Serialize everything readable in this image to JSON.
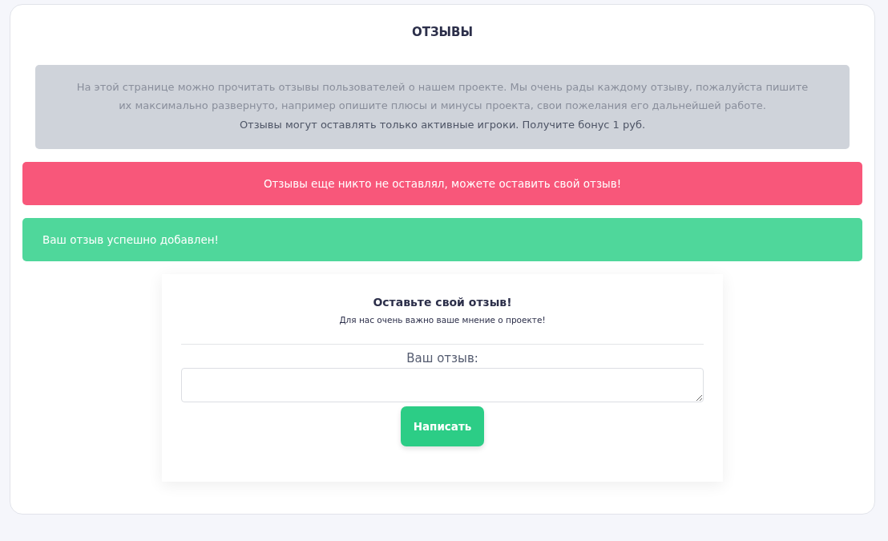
{
  "page_title": "ОТЗЫВЫ",
  "info": {
    "text": "На этой странице можно прочитать отзывы пользователей о нашем проекте. Мы очень рады каждому отзыву, пожалуйста пишите их максимально развернуто, например опишите плюсы и минусы проекта, свои пожелания его дальнейшей работе.",
    "note": "Отзывы могут оставлять только активные игроки. Получите бонус 1 руб."
  },
  "alerts": [
    {
      "kind": "danger",
      "text": "Отзывы еще никто не оставлял, можете оставить свой отзыв!"
    },
    {
      "kind": "success",
      "text": "Ваш отзыв успешно добавлен!"
    }
  ],
  "form": {
    "title": "Оставьте свой отзыв!",
    "subtitle": "Для нас очень важно ваше мнение о проекте!",
    "label": "Ваш отзыв:",
    "button": "Написать"
  }
}
